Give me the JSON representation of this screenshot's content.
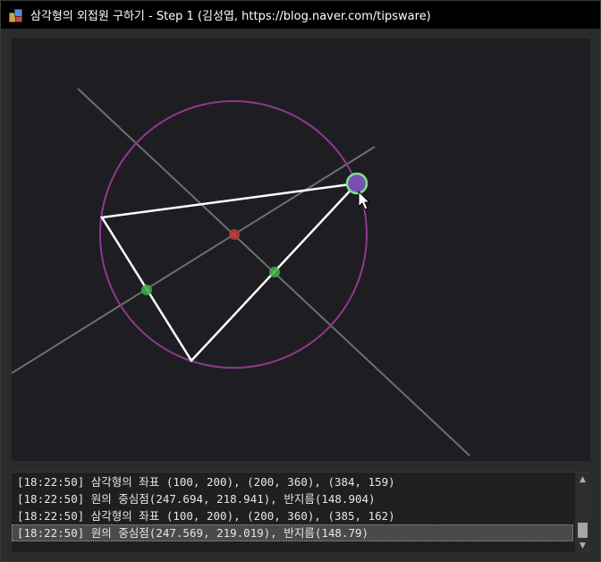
{
  "window": {
    "title": "삼각형의 외접원 구하기 - Step 1 (김성엽, https://blog.naver.com/tipsware)",
    "icon": "app-cubes-icon"
  },
  "colors": {
    "canvas_bg": "#1e1e22",
    "circle": "#8e3a8c",
    "triangle": "#ffffff",
    "bisector": "#6e6e6e",
    "midpoint": "#3fae4a",
    "center": "#c0393b",
    "handle_fill": "#7b4fb0",
    "handle_ring": "#7fe08a"
  },
  "log": {
    "lines": [
      "[18:22:50] 삼각형의 좌표 (100, 200), (200, 360), (384, 159)",
      "[18:22:50] 원의 중심점(247.694, 218.941), 반지름(148.904)",
      "[18:22:50] 삼각형의 좌표 (100, 200), (200, 360), (385, 162)",
      "[18:22:50] 원의 중심점(247.569, 219.019), 반지름(148.79)"
    ],
    "selected_index": 3
  }
}
